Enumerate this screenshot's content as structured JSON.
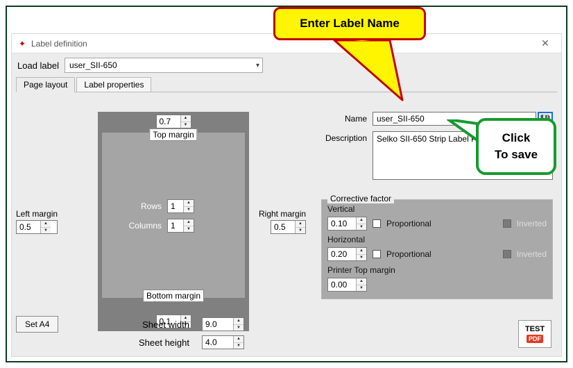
{
  "callouts": {
    "enter_label": "Enter Label Name",
    "click_save_line1": "Click",
    "click_save_line2": "To save"
  },
  "window": {
    "title": "Label definition"
  },
  "load_label": {
    "caption": "Load label",
    "value": "user_SII-650"
  },
  "tabs": {
    "page_layout": "Page layout",
    "label_properties": "Label properties"
  },
  "preview": {
    "top_margin_value": "0.7",
    "top_margin_label": "Top margin",
    "rows_label": "Rows",
    "rows_value": "1",
    "columns_label": "Columns",
    "columns_value": "1",
    "bottom_margin_label": "Bottom margin",
    "bottom_margin_value": "0.1"
  },
  "left_margin": {
    "label": "Left margin",
    "value": "0.5"
  },
  "right_margin": {
    "label": "Right margin",
    "value": "0.5"
  },
  "name_field": {
    "label": "Name",
    "value": "user_SII-650"
  },
  "description_field": {
    "label": "Description",
    "value": "Selko SII-650 Strip Label Printer"
  },
  "corrective": {
    "group_title": "Corrective factor",
    "vertical_label": "Vertical",
    "vertical_value": "0.10",
    "horizontal_label": "Horizontal",
    "horizontal_value": "0.20",
    "printer_top_label": "Printer Top margin",
    "printer_top_value": "0.00",
    "proportional_label": "Proportional",
    "inverted_label": "Inverted"
  },
  "buttons": {
    "set_a4": "Set A4",
    "test": "TEST",
    "pdf": "PDF"
  },
  "sheet": {
    "width_label": "Sheet width",
    "width_value": "9.0",
    "height_label": "Sheet height",
    "height_value": "4.0"
  },
  "icons": {
    "save": "💾"
  }
}
